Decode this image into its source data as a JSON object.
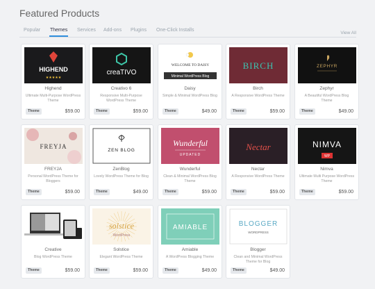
{
  "page": {
    "title": "Featured Products"
  },
  "tabs": [
    {
      "label": "Popular"
    },
    {
      "label": "Themes",
      "active": true
    },
    {
      "label": "Services"
    },
    {
      "label": "Add-ons"
    },
    {
      "label": "Plugins"
    },
    {
      "label": "One-Click Installs"
    }
  ],
  "view_all": "View All",
  "products": [
    {
      "name": "Highend",
      "desc": "Ultimate Multi-Purpose WordPress Theme",
      "tag": "Theme",
      "price": "$59.00",
      "thumb": {
        "bg": "#1a1a1c",
        "text": "HIGHEND",
        "color": "#ffffff",
        "icon": "ruby-gem-icon",
        "extra": "★★★★★"
      }
    },
    {
      "name": "Creativo 6",
      "desc": "Responsive Multi-Purpose WordPress Theme",
      "tag": "Theme",
      "price": "$59.00",
      "thumb": {
        "bg": "#151515",
        "text": "creaTIVO",
        "color": "#ffffff",
        "icon": "hexagon-logo-icon"
      }
    },
    {
      "name": "Daisy",
      "desc": "Simple & Minimal WordPress Blog",
      "tag": "Theme",
      "price": "$49.00",
      "thumb": {
        "bg": "#ffffff",
        "text": "WELCOME TO DAISY",
        "color": "#333333",
        "icon": "daisy-flower-icon",
        "extra": "Minimal WordPress Blog"
      }
    },
    {
      "name": "Birch",
      "desc": "A Responsive WordPress Theme",
      "tag": "Theme",
      "price": "$59.00",
      "thumb": {
        "bg": "#6f2b35",
        "text": "BIRCH",
        "color": "#3cc3b0"
      }
    },
    {
      "name": "Zephyr",
      "desc": "A Beautiful WordPress Blog Theme",
      "tag": "Theme",
      "price": "$49.00",
      "thumb": {
        "bg": "#111111",
        "text": "ZEPHYR",
        "color": "#c9a560",
        "icon": "feather-logo-icon"
      }
    },
    {
      "name": "FREYJA",
      "desc": "Personal WordPress Theme for Bloggers",
      "tag": "Theme",
      "price": "$59.00",
      "thumb": {
        "bg": "#efe7e0",
        "text": "FREYJA",
        "color": "#333333",
        "icon": "flowers-icon"
      }
    },
    {
      "name": "ZenBlog",
      "desc": "Lovely WordPress Theme for Blog",
      "tag": "Theme",
      "price": "$49.00",
      "thumb": {
        "bg": "#ffffff",
        "text": "ZEN BLOG",
        "color": "#222222",
        "icon": "zen-swirl-icon"
      }
    },
    {
      "name": "Wunderful",
      "desc": "Clean & Minimal WordPress Blog Theme",
      "tag": "Theme",
      "price": "$59.00",
      "thumb": {
        "bg": "#c14f6e",
        "text": "Wunderful",
        "color": "#ffffff",
        "extra": "UPDATED"
      }
    },
    {
      "name": "Nectar",
      "desc": "A Responsive WordPress Theme",
      "tag": "Theme",
      "price": "$59.00",
      "thumb": {
        "bg": "#2a1f26",
        "text": "Nectar",
        "color": "#e5514a"
      }
    },
    {
      "name": "Nimva",
      "desc": "Ultimate Multi Purpose WordPress Theme",
      "tag": "Theme",
      "price": "$59.00",
      "thumb": {
        "bg": "#151515",
        "text": "NIMVA",
        "color": "#ffffff",
        "extra": "WP"
      }
    },
    {
      "name": "Creative",
      "desc": "Blog WordPress Theme",
      "tag": "Theme",
      "price": "$59.00",
      "thumb": {
        "bg": "#ffffff",
        "icon": "device-mockup-icon"
      }
    },
    {
      "name": "Solstice",
      "desc": "Elegant WordPress Theme",
      "tag": "Theme",
      "price": "$59.00",
      "thumb": {
        "bg": "#faf3e6",
        "text": "solstice",
        "color": "#d4a03c",
        "icon": "sunburst-icon",
        "extra": "WordPress"
      }
    },
    {
      "name": "Amiable",
      "desc": "A WordPress Blogging Theme",
      "tag": "Theme",
      "price": "$49.00",
      "thumb": {
        "bg": "#7fcfb9",
        "text": "AMIABLE",
        "color": "#ffffff"
      }
    },
    {
      "name": "Blogger",
      "desc": "Clean and Minimal WordPress Theme for Blog",
      "tag": "Theme",
      "price": "$49.00",
      "thumb": {
        "bg": "#ffffff",
        "text": "BLOGGER",
        "color": "#5aa9c4",
        "extra": "WORDPRESS"
      }
    }
  ]
}
